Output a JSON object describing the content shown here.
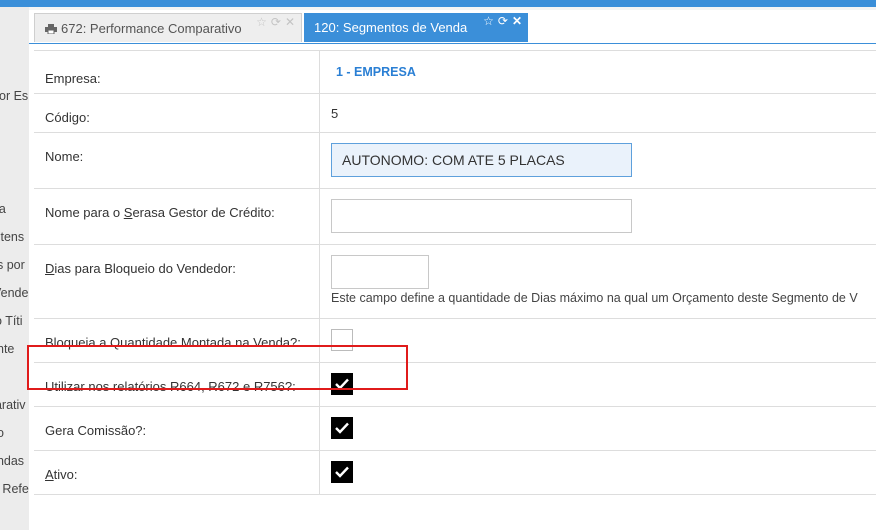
{
  "sidebar": {
    "items": [
      "or Es",
      "nda",
      "Itens",
      "s por",
      "Vende",
      "o Títi",
      "nte",
      "parativ",
      "o",
      "endas",
      "e Refe"
    ]
  },
  "tabs": [
    {
      "label": "672: Performance Comparativo",
      "active": false
    },
    {
      "label": "120: Segmentos de Venda",
      "active": true
    }
  ],
  "form": {
    "empresa": {
      "label": "Empresa:",
      "value": "1 - EMPRESA"
    },
    "codigo": {
      "label": "Código:",
      "value": "5"
    },
    "nome": {
      "label": "Nome:",
      "value": "AUTONOMO: COM ATE 5 PLACAS"
    },
    "serasa": {
      "label_pre": "Nome para o ",
      "label_u": "S",
      "label_post": "erasa Gestor de Crédito:",
      "value": ""
    },
    "dias": {
      "label_u": "D",
      "label_post": "ias para Bloqueio do Vendedor:",
      "value": "",
      "hint": "Este campo define a quantidade de Dias máximo na qual um Orçamento deste Segmento de V"
    },
    "bloqueia": {
      "label": "Bloqueia a Quantidade Montada na Venda?:",
      "checked": false
    },
    "utilizar": {
      "label": "Utilizar nos relatórios R664, R672 e R756?:",
      "checked": true
    },
    "comissao": {
      "label": "Gera Comissão?:",
      "checked": true
    },
    "ativo": {
      "label_u": "A",
      "label_post": "tivo:",
      "checked": true
    }
  },
  "colors": {
    "accent": "#3b8fd9",
    "highlight": "#e01b1b"
  }
}
